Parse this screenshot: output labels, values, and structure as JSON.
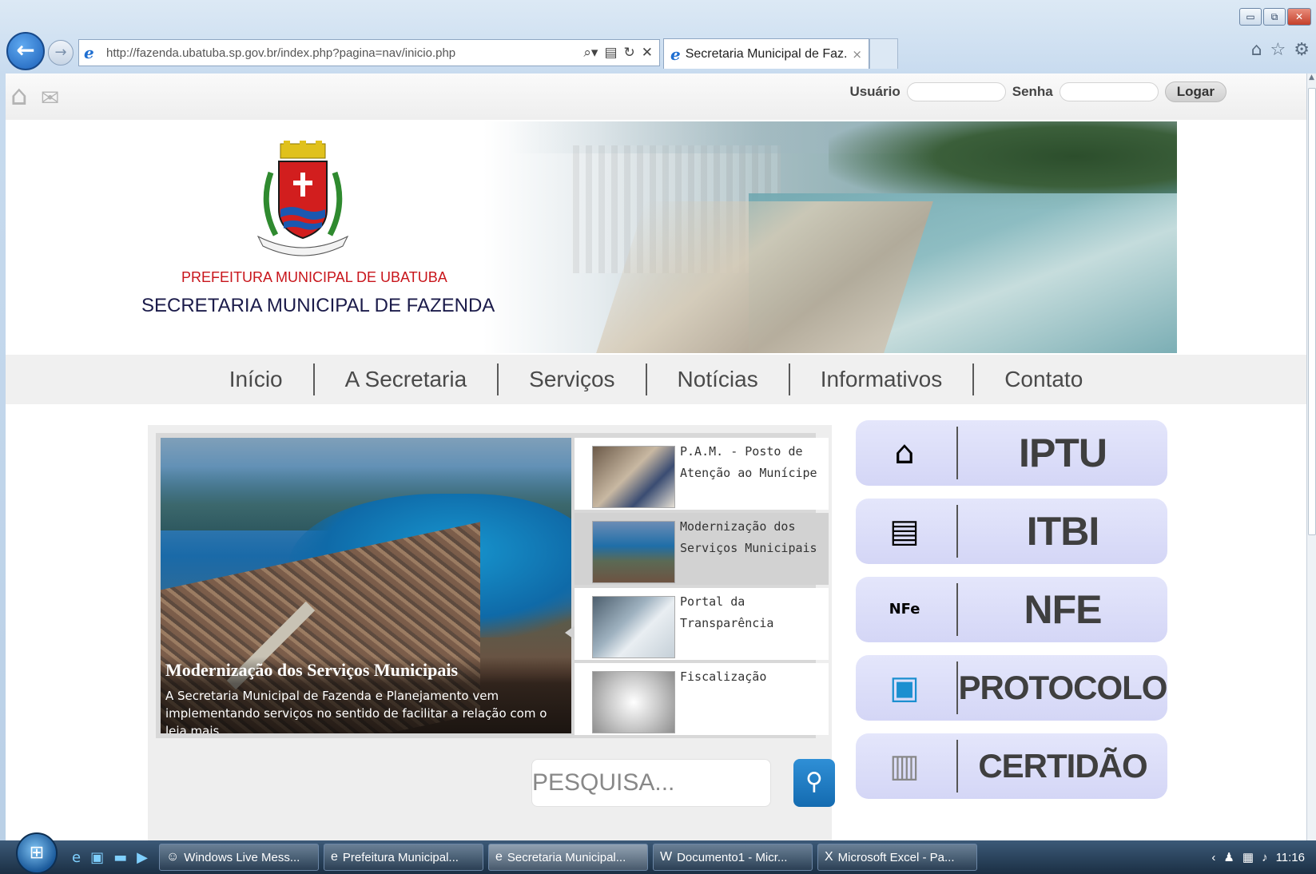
{
  "browser": {
    "url": "http://fazenda.ubatuba.sp.gov.br/index.php?pagina=nav/inicio.php",
    "tab_title": "Secretaria Municipal de Faz...",
    "tab_close": "×",
    "window_buttons": {
      "minimize": "▭",
      "restore": "⧉",
      "close": "✕"
    },
    "toolbar_icons": [
      "home-icon",
      "star-icon",
      "gear-icon"
    ]
  },
  "page": {
    "login": {
      "user_label": "Usuário",
      "pass_label": "Senha",
      "button": "Logar",
      "user_value": "",
      "pass_value": ""
    },
    "header": {
      "prefeitura": "PREFEITURA MUNICIPAL DE UBATUBA",
      "secretaria": "SECRETARIA MUNICIPAL DE FAZENDA"
    },
    "menu": [
      "Início",
      "A Secretaria",
      "Serviços",
      "Notícias",
      "Informativos",
      "Contato"
    ],
    "slider": {
      "main_title": "Modernização dos Serviços Municipais",
      "main_text": "A Secretaria Municipal de Fazenda e Planejamento vem implementando serviços no sentido de facilitar a relação com o leia mais",
      "items": [
        {
          "label": "P.A.M. - Posto de Atenção ao Munícipe"
        },
        {
          "label": "Modernização dos Serviços Municipais"
        },
        {
          "label": "Portal da Transparência"
        },
        {
          "label": "Fiscalização"
        }
      ]
    },
    "search": {
      "placeholder": "PESQUISA..."
    },
    "services": [
      {
        "name": "IPTU",
        "icon": "house-icon"
      },
      {
        "name": "ITBI",
        "icon": "document-coins-icon"
      },
      {
        "name": "NFE",
        "icon": "nfe-badge-icon"
      },
      {
        "name": "PROTOCOLO",
        "icon": "filing-cabinet-icon"
      },
      {
        "name": "CERTIDÃO",
        "icon": "certificate-icon"
      }
    ]
  },
  "taskbar": {
    "tasks": [
      {
        "label": "Windows Live Mess..."
      },
      {
        "label": "Prefeitura Municipal..."
      },
      {
        "label": "Secretaria Municipal..."
      },
      {
        "label": "Documento1 - Micr..."
      },
      {
        "label": "Microsoft Excel - Pa..."
      }
    ],
    "clock": "11:16"
  }
}
